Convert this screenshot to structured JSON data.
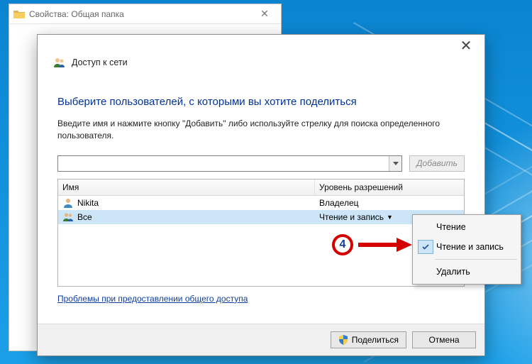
{
  "parent_window": {
    "title": "Свойства: Общая папка"
  },
  "dialog": {
    "header": "Доступ к сети",
    "heading": "Выберите пользователей, с которыми вы хотите поделиться",
    "instruction": "Введите имя и нажмите кнопку \"Добавить\" либо используйте стрелку для поиска определенного пользователя.",
    "name_value": "",
    "add_button": "Добавить",
    "columns": {
      "name": "Имя",
      "perm": "Уровень разрешений"
    },
    "rows": [
      {
        "name": "Nikita",
        "perm": "Владелец",
        "dropdown": false
      },
      {
        "name": "Все",
        "perm": "Чтение и запись",
        "dropdown": true
      }
    ],
    "troubleshoot": "Проблемы при предоставлении общего доступа",
    "share_button": "Поделиться",
    "cancel_button": "Отмена"
  },
  "context_menu": {
    "items": {
      "read": "Чтение",
      "readwrite": "Чтение и запись",
      "remove": "Удалить"
    },
    "checked_index": 1
  },
  "annotation": {
    "number": "4"
  }
}
